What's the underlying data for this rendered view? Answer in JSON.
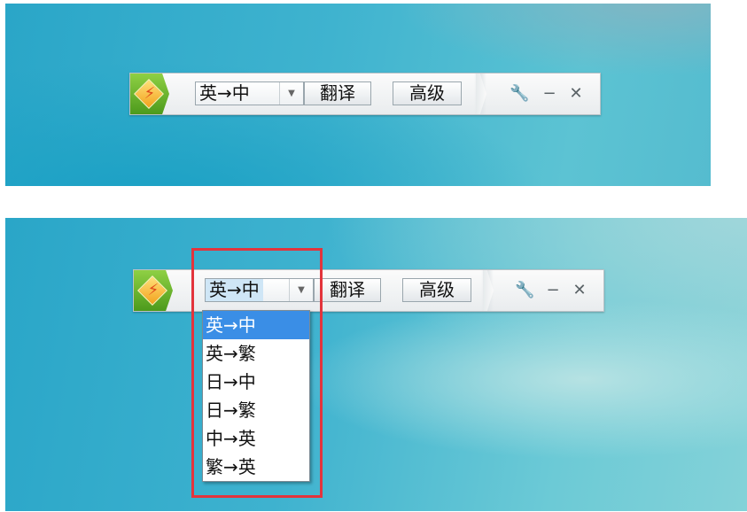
{
  "toolbar_top": {
    "language_value": "英→中",
    "translate_label": "翻译",
    "advanced_label": "高级"
  },
  "toolbar_bottom": {
    "language_value": "英→中",
    "translate_label": "翻译",
    "advanced_label": "高级"
  },
  "dropdown": {
    "options": [
      "英→中",
      "英→繁",
      "日→中",
      "日→繁",
      "中→英",
      "繁→英"
    ],
    "selected_index": 0
  },
  "icons": {
    "logo": "app-logo-icon",
    "settings": "wrench-icon",
    "minimize": "minimize-icon",
    "close": "close-icon",
    "dropdown_arrow": "chevron-down-icon"
  },
  "colors": {
    "highlight_border": "#e3343c",
    "selected_option_bg": "#3a8ee6",
    "logo_green": "#6bb52e"
  }
}
